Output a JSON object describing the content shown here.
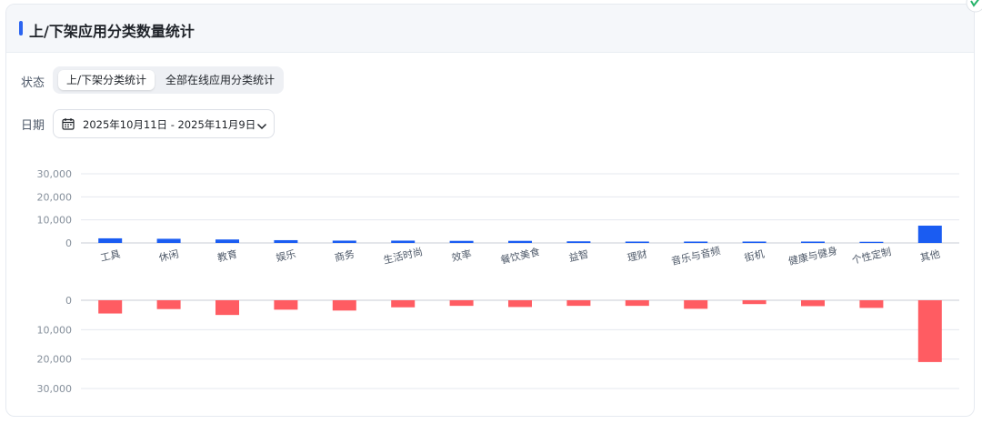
{
  "card": {
    "title": "上/下架应用分类数量统计"
  },
  "filters": {
    "status_label": "状态",
    "status_options": [
      "上/下架分类统计",
      "全部在线应用分类统计"
    ],
    "status_selected": "上/下架分类统计",
    "date_label": "日期",
    "date_range": "2025年10月11日 - 2025年11月9日"
  },
  "colors": {
    "accent": "#2b64f0",
    "removed": "#ff5c62",
    "up_bar": "#1a5cf2"
  },
  "icons": [
    "calendar-icon",
    "chevron-down-icon"
  ],
  "chart_data": [
    {
      "type": "bar",
      "categories": [
        "工具",
        "休闲",
        "教育",
        "娱乐",
        "商务",
        "生活时尚",
        "效率",
        "餐饮美食",
        "益智",
        "理财",
        "音乐与音频",
        "街机",
        "健康与健身",
        "个性定制",
        "其他"
      ],
      "values": [
        2000,
        1800,
        1500,
        1200,
        1000,
        1000,
        900,
        900,
        700,
        600,
        600,
        600,
        600,
        500,
        7500
      ],
      "ylim": [
        0,
        30000
      ],
      "yticks": [
        "0",
        "10,000",
        "20,000",
        "30,000"
      ],
      "grid": true
    },
    {
      "type": "bar",
      "categories": [
        "工具",
        "休闲",
        "教育",
        "娱乐",
        "商务",
        "生活时尚",
        "效率",
        "餐饮美食",
        "益智",
        "理财",
        "音乐与音频",
        "街机",
        "健康与健身",
        "个性定制",
        "其他"
      ],
      "values": [
        4500,
        3000,
        5000,
        3200,
        3500,
        2400,
        1900,
        2300,
        1900,
        1900,
        2900,
        1300,
        2000,
        2600,
        21000
      ],
      "ylim": [
        0,
        30000
      ],
      "yticks": [
        "0",
        "10,000",
        "20,000",
        "30,000"
      ],
      "grid": true
    }
  ]
}
